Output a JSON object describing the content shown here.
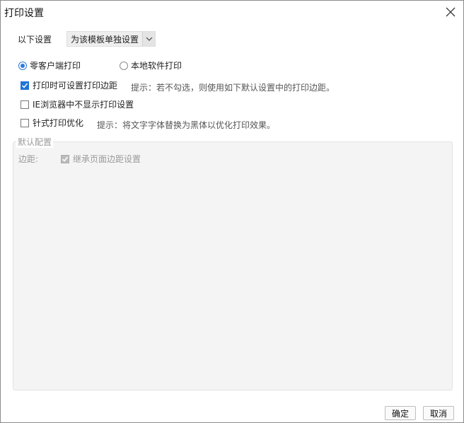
{
  "dialog": {
    "title": "打印设置",
    "close_icon": "close-icon"
  },
  "scope": {
    "label": "以下设置",
    "selected": "为该模板单独设置"
  },
  "print_mode": {
    "options": [
      {
        "label": "零客户端打印",
        "selected": true
      },
      {
        "label": "本地软件打印",
        "selected": false
      }
    ]
  },
  "options": {
    "set_margin_label": "打印时可设置打印边距",
    "set_margin_checked": true,
    "set_margin_hint": "提示：若不勾选，则使用如下默认设置中的打印边距。",
    "ie_hide_label": "IE浏览器中不显示打印设置",
    "ie_hide_checked": false,
    "dot_matrix_label": "针式打印优化",
    "dot_matrix_checked": false,
    "dot_matrix_hint": "提示：将文字字体替换为黑体以优化打印效果。"
  },
  "default_config": {
    "title": "默认配置",
    "margin_label": "边距:",
    "inherit_label": "继承页面边距设置",
    "inherit_checked": true
  },
  "footer": {
    "ok_label": "确定",
    "cancel_label": "取消"
  },
  "colors": {
    "accent": "#1f74d8",
    "disabled_text": "#9a9a9a",
    "group_bg": "#f4f4f4"
  }
}
